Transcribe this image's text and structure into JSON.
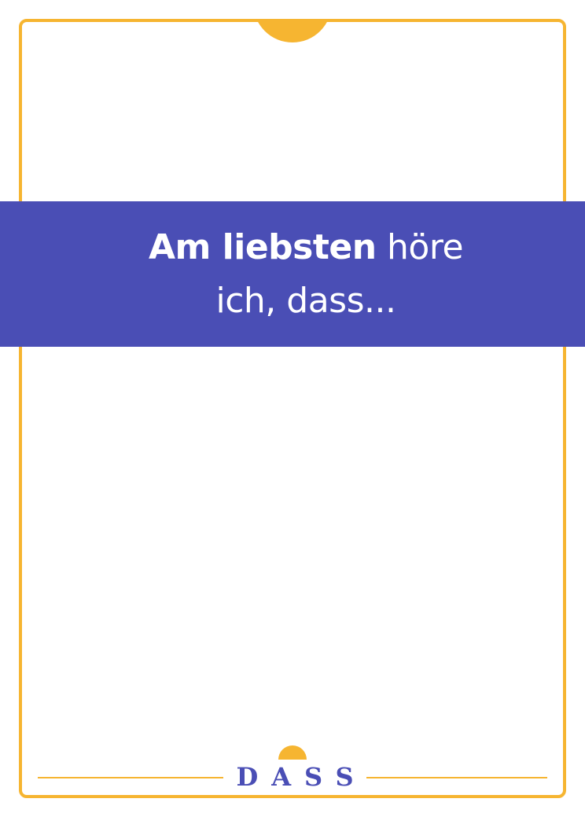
{
  "card": {
    "prompt_bold": "Am liebsten",
    "prompt_after_bold": "höre",
    "prompt_line2": "ich, dass..."
  },
  "brand": {
    "logo_text": "DASS"
  },
  "colors": {
    "accent": "#f6b531",
    "banner": "#4a4eb5",
    "background": "#ffffff"
  }
}
